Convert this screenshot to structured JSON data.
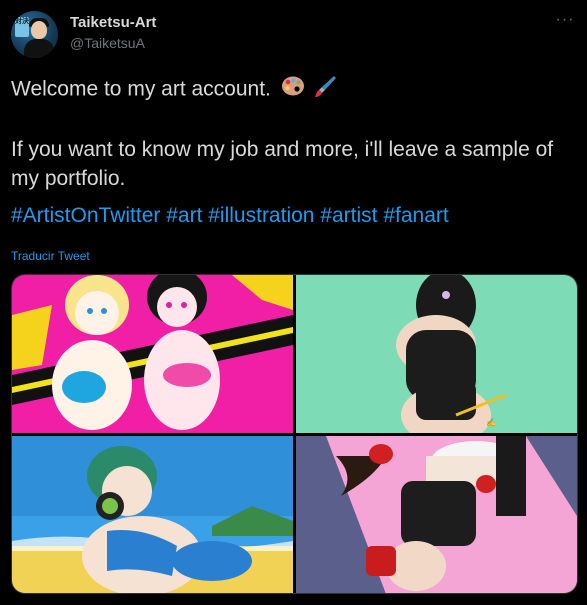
{
  "author": {
    "display_name": "Taiketsu-Art",
    "handle": "@TaiketsuA",
    "avatar_badge": "対決"
  },
  "more_icon": "···",
  "tweet": {
    "line1": "Welcome to my art account.",
    "line2": "If you want to know my job and more, i'll leave a sample of my portfolio.",
    "hashtags": [
      "#ArtistOnTwitter",
      "#art",
      "#illustration",
      "#artist",
      "#fanart"
    ]
  },
  "translate_label": "Traducir Tweet",
  "colors": {
    "background": "#000000",
    "text": "#d9d9d9",
    "secondary": "#6e767d",
    "link": "#1d9bf0"
  },
  "media": [
    {
      "name": "pink-yellow-artwork"
    },
    {
      "name": "mint-background-artwork"
    },
    {
      "name": "beach-headphones-artwork"
    },
    {
      "name": "pink-purple-fighter-artwork"
    }
  ]
}
